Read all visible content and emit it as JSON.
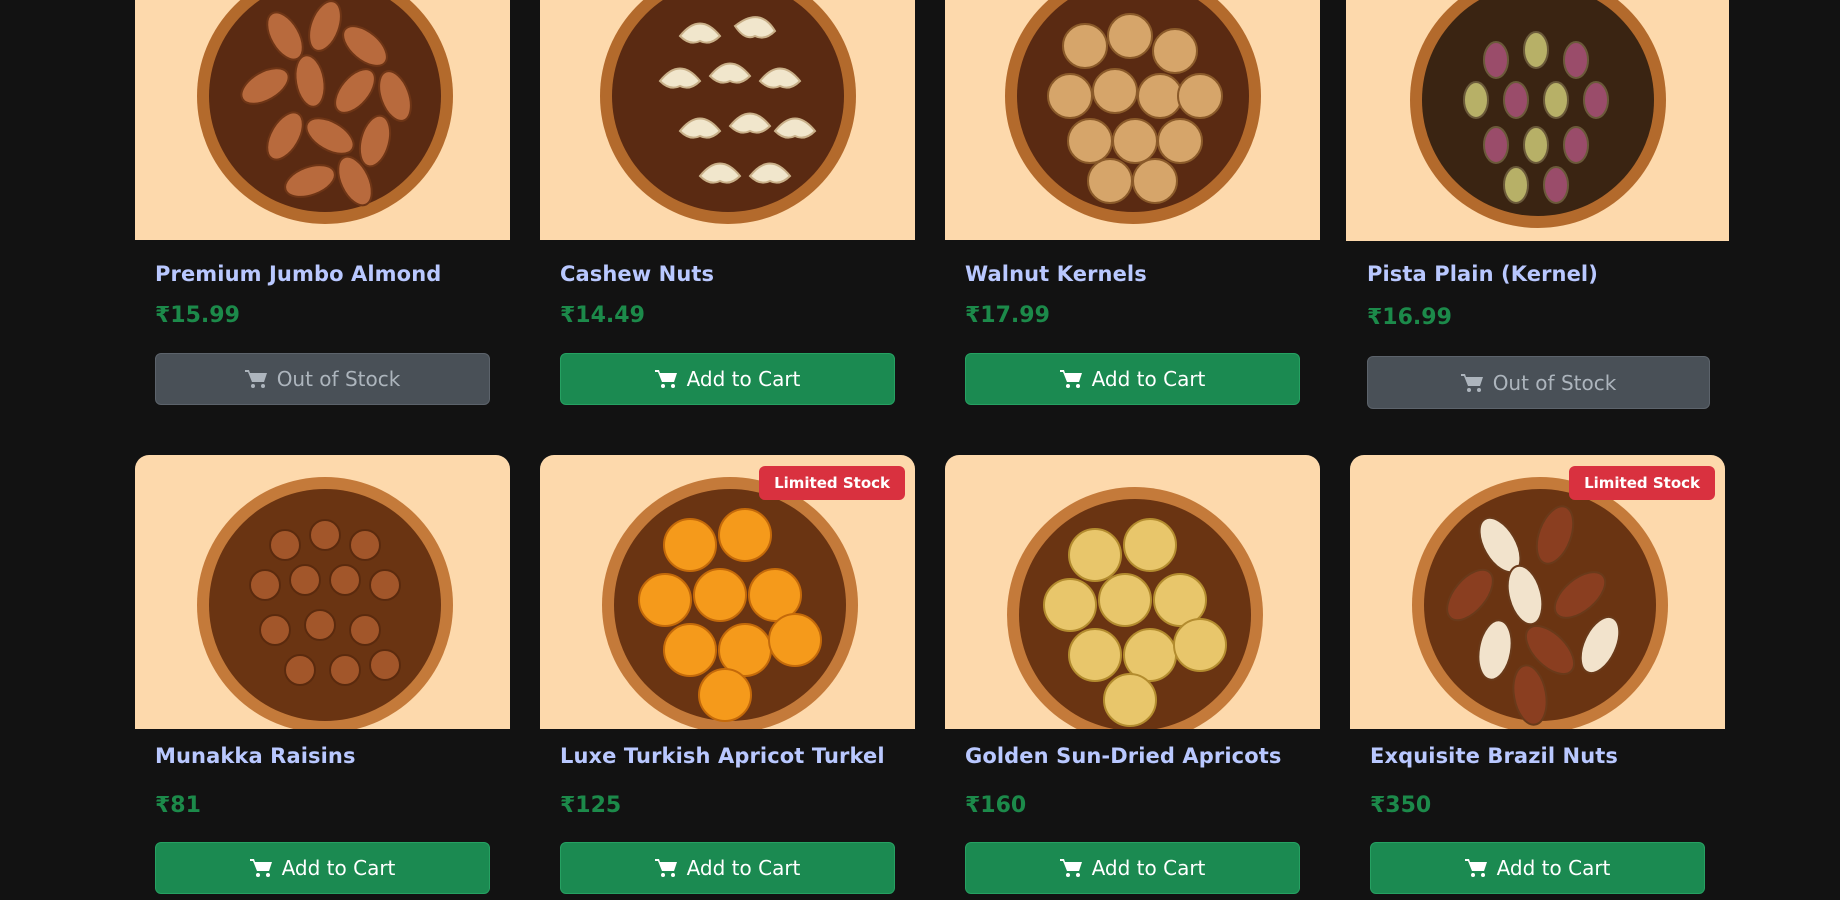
{
  "products": [
    {
      "name": "Premium Jumbo Almond",
      "price": "₹15.99",
      "button": "Out of Stock",
      "in_stock": false,
      "badge": "",
      "image_icon": "almonds-bowl-image"
    },
    {
      "name": "Cashew Nuts",
      "price": "₹14.49",
      "button": "Add to Cart",
      "in_stock": true,
      "badge": "",
      "image_icon": "cashews-bowl-image"
    },
    {
      "name": "Walnut Kernels",
      "price": "₹17.99",
      "button": "Add to Cart",
      "in_stock": true,
      "badge": "",
      "image_icon": "walnuts-bowl-image"
    },
    {
      "name": "Pista Plain (Kernel)",
      "price": "₹16.99",
      "button": "Out of Stock",
      "in_stock": false,
      "badge": "",
      "image_icon": "pistachios-bowl-image"
    },
    {
      "name": "Munakka Raisins",
      "price": "₹81",
      "button": "Add to Cart",
      "in_stock": true,
      "badge": "",
      "image_icon": "raisins-bowl-image"
    },
    {
      "name": "Luxe Turkish Apricot Turkel",
      "price": "₹125",
      "button": "Add to Cart",
      "in_stock": true,
      "badge": "Limited Stock",
      "image_icon": "apricots-bowl-image"
    },
    {
      "name": "Golden Sun-Dried Apricots",
      "price": "₹160",
      "button": "Add to Cart",
      "in_stock": true,
      "badge": "",
      "image_icon": "golden-apricots-bowl-image"
    },
    {
      "name": "Exquisite Brazil Nuts",
      "price": "₹350",
      "button": "Add to Cart",
      "in_stock": true,
      "badge": "Limited Stock",
      "image_icon": "brazil-nuts-bowl-image"
    }
  ],
  "colors": {
    "page_bg": "#121212",
    "image_bg": "#fdd9ac",
    "product_name": "#b9c8ff",
    "price": "#1c8a4a",
    "button_green": "#1b8a51",
    "button_gray": "#495057",
    "badge_red": "#d9313f"
  },
  "icons": {
    "cart": "shopping-cart-icon"
  }
}
